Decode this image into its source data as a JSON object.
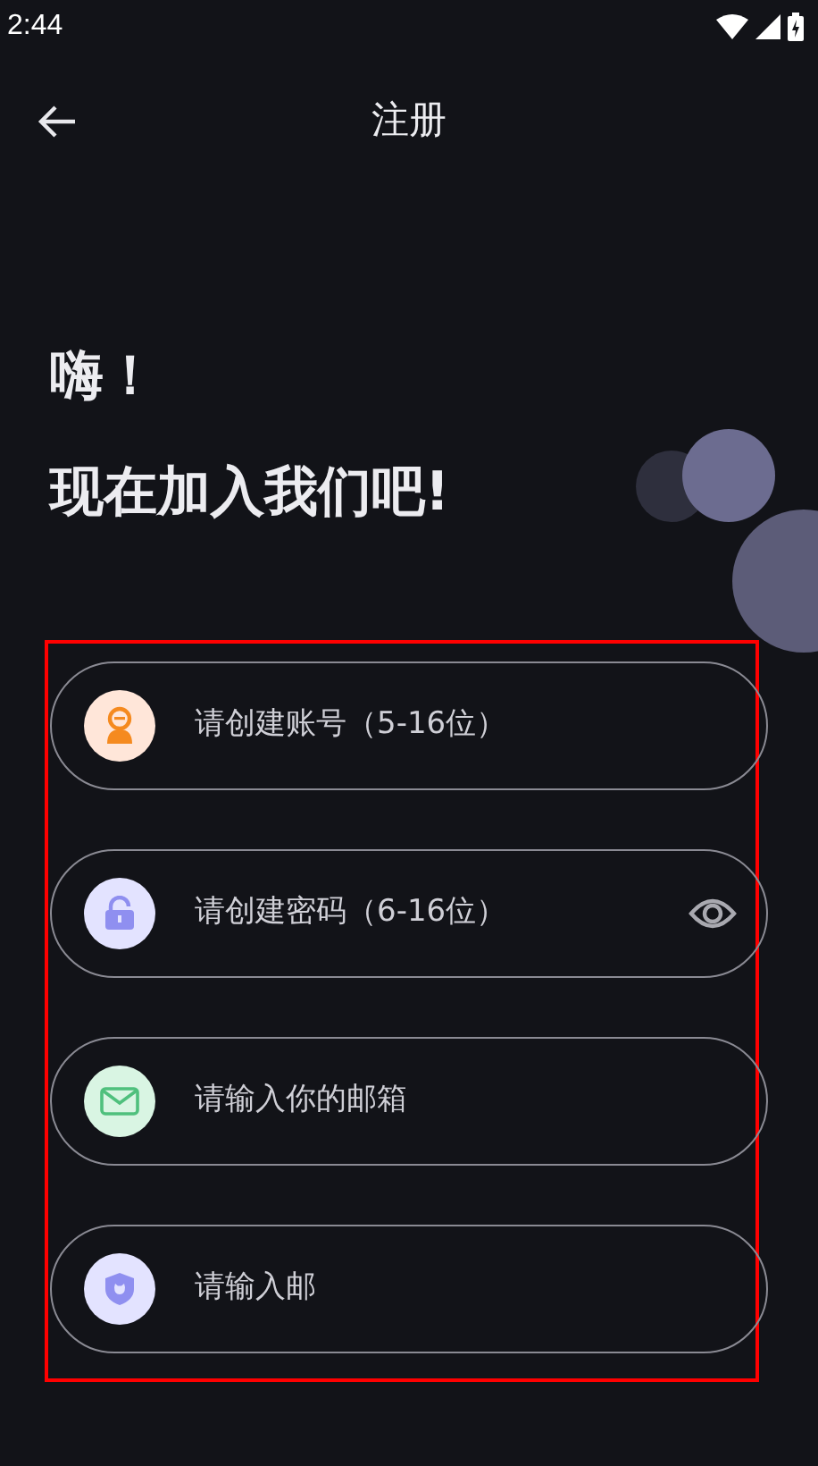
{
  "status_bar": {
    "time": "2:44"
  },
  "header": {
    "title": "注册"
  },
  "greeting": {
    "line_1": "嗨！",
    "line_2": "现在加入我们吧!"
  },
  "fields": [
    {
      "kind": "account",
      "placeholder": "请创建账号（5-16位）",
      "color": "#ffe6d9"
    },
    {
      "kind": "password",
      "placeholder": "请创建密码（6-16位）",
      "color": "#e3e3ff"
    },
    {
      "kind": "email",
      "placeholder": "请输入你的邮箱",
      "color": "#d9f5e3"
    },
    {
      "kind": "code",
      "placeholder": "请输入邮",
      "color": "#e3e3ff"
    }
  ]
}
